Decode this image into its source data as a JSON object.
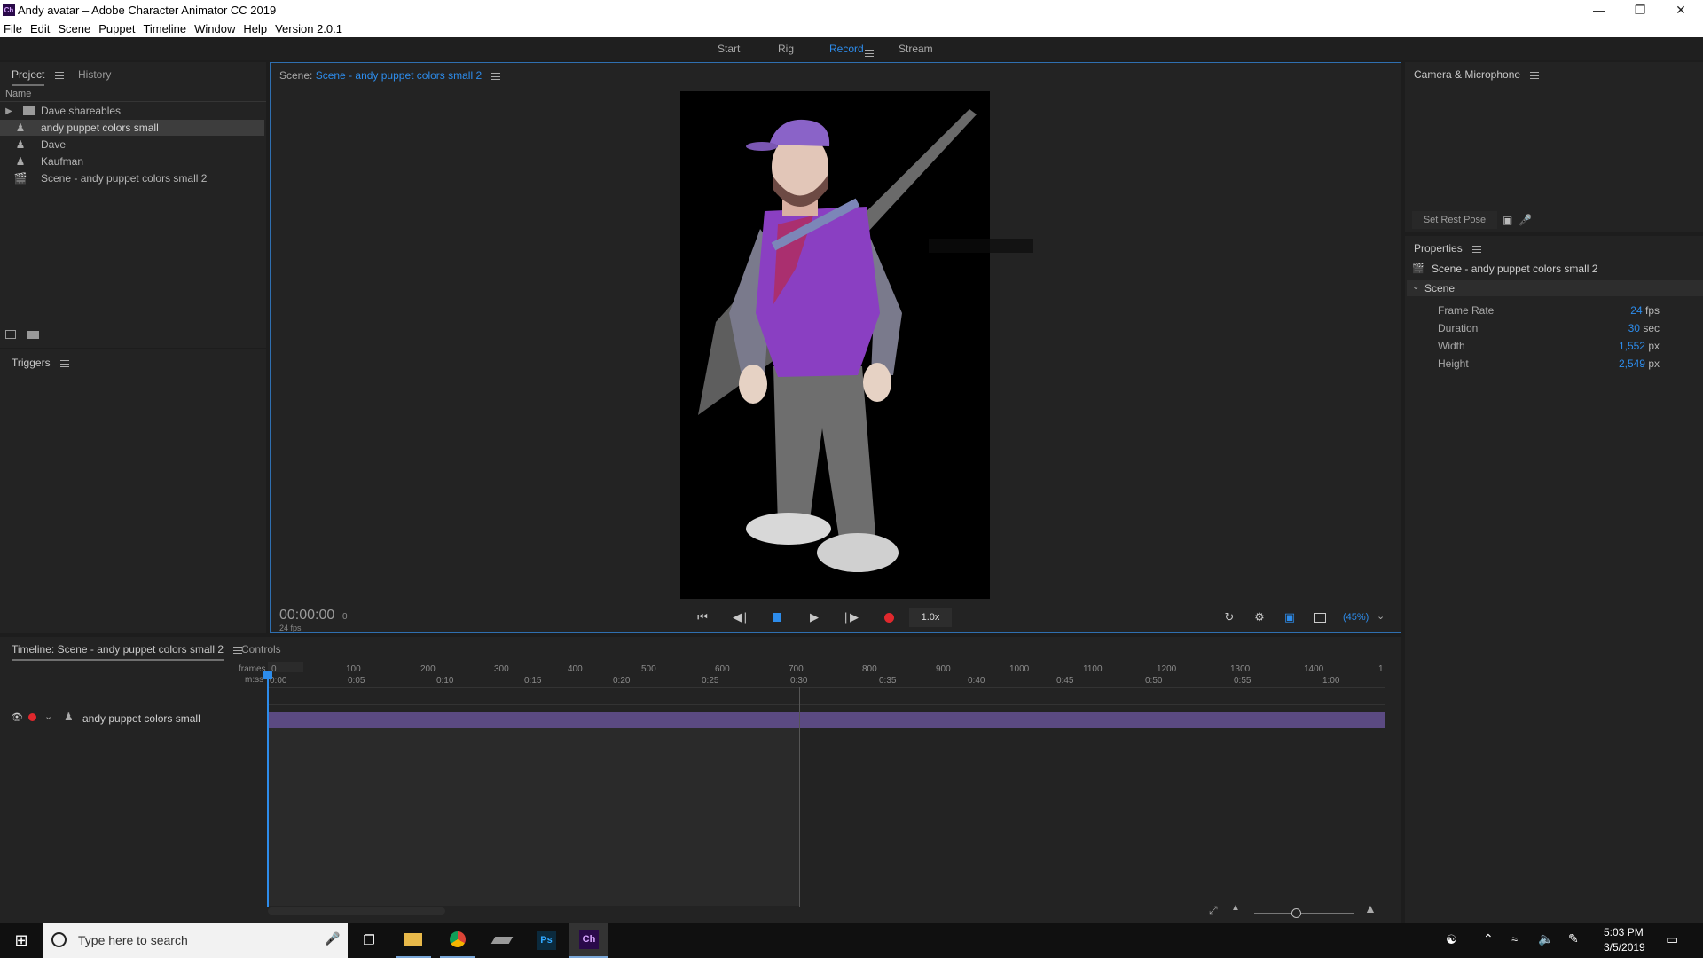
{
  "window": {
    "title": "Andy avatar – Adobe Character Animator CC 2019",
    "app_icon": "Ch",
    "controls": [
      "minimize-icon",
      "restore-icon",
      "close-icon"
    ]
  },
  "menu": [
    "File",
    "Edit",
    "Scene",
    "Puppet",
    "Timeline",
    "Window",
    "Help",
    "Version 2.0.1"
  ],
  "workspaces": {
    "items": [
      "Start",
      "Rig",
      "Record",
      "Stream"
    ],
    "active": "Record"
  },
  "project_panel": {
    "tabs": [
      "Project",
      "History"
    ],
    "column_header": "Name",
    "items": [
      {
        "label": "Dave shareables",
        "icon": "folder-icon",
        "expandable": true
      },
      {
        "label": "andy puppet colors small",
        "icon": "puppet-icon",
        "selected": true
      },
      {
        "label": "Dave",
        "icon": "puppet-icon"
      },
      {
        "label": "Kaufman",
        "icon": "puppet-icon"
      },
      {
        "label": "Scene - andy puppet colors small 2",
        "icon": "scene-icon"
      }
    ]
  },
  "triggers_panel": {
    "title": "Triggers"
  },
  "scene_panel": {
    "label": "Scene:",
    "scene_name": "Scene - andy puppet colors small 2",
    "timecode": "00:00:00",
    "frame": "0",
    "fps_label": "24 fps",
    "speed": "1.0x",
    "zoom": "(45%)"
  },
  "camera_panel": {
    "title": "Camera & Microphone",
    "set_rest_pose": "Set Rest Pose"
  },
  "properties_panel": {
    "title": "Properties",
    "object_name": "Scene - andy puppet colors small 2",
    "section": "Scene",
    "rows": [
      {
        "key": "Frame Rate",
        "value": "24",
        "unit": "fps"
      },
      {
        "key": "Duration",
        "value": "30",
        "unit": "sec"
      },
      {
        "key": "Width",
        "value": "1,552",
        "unit": "px"
      },
      {
        "key": "Height",
        "value": "2,549",
        "unit": "px"
      }
    ]
  },
  "timeline_panel": {
    "tabs": [
      "Timeline: Scene - andy puppet colors small 2",
      "Controls"
    ],
    "frames_label": "frames",
    "mss_label": "m:ss",
    "frame_ticks": [
      "0",
      "100",
      "200",
      "300",
      "400",
      "500",
      "600",
      "700",
      "800",
      "900",
      "1000",
      "1100",
      "1200",
      "1300",
      "1400",
      "1"
    ],
    "time_ticks": [
      "0:00",
      "0:05",
      "0:10",
      "0:15",
      "0:20",
      "0:25",
      "0:30",
      "0:35",
      "0:40",
      "0:45",
      "0:50",
      "0:55",
      "1:00"
    ],
    "track_label": "andy puppet colors small"
  },
  "taskbar": {
    "search_placeholder": "Type here to search",
    "apps": [
      "task-view-icon",
      "file-explorer-icon",
      "chrome-icon",
      "app-icon",
      "photoshop-icon",
      "character-animator-icon"
    ],
    "ps_label": "Ps",
    "ch_label": "Ch",
    "time": "5:03 PM",
    "date": "3/5/2019"
  },
  "colors": {
    "accent": "#2d8ceb",
    "record_red": "#e0282d",
    "track_purple": "#5b4a82",
    "ch_purple": "#2a0a4a"
  }
}
